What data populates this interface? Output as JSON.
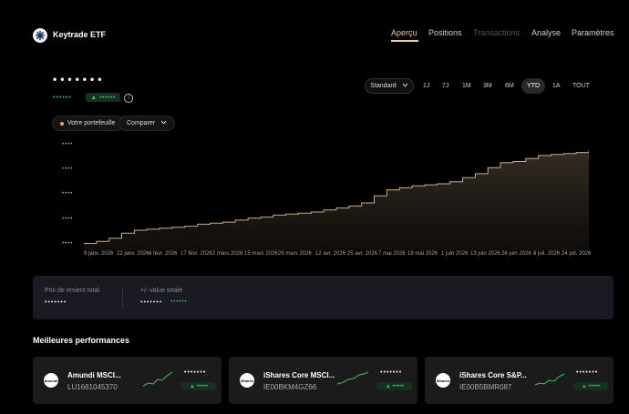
{
  "header": {
    "app_title": "Keytrade ETF",
    "nav": [
      {
        "label": "Aperçu"
      },
      {
        "label": "Positions"
      },
      {
        "label": "Transactions"
      },
      {
        "label": "Analyse"
      },
      {
        "label": "Paramètres"
      }
    ]
  },
  "summary": {
    "value_masked": "•••••••",
    "gain_masked": "••••••",
    "gain_badge": "▲ ••••••",
    "info": "i"
  },
  "controls": {
    "portfolio_label": "Votre portefeuille",
    "compare_label": "Comparer",
    "view_label": "Standard",
    "periods": [
      "1J",
      "7J",
      "1M",
      "3M",
      "6M",
      "YTD",
      "1A",
      "TOUT"
    ],
    "active_period": "YTD"
  },
  "chart_data": {
    "type": "area",
    "ytick_labels": [
      "••••",
      "••••",
      "••••",
      "••••",
      "••••"
    ],
    "xtick_labels": [
      "9 janv. 2026",
      "22 janv. 2026",
      "4 févr. 2026",
      "17 févr. 2026",
      "2 mars 2026",
      "15 mars 2026",
      "29 mars 2026",
      "12 avr. 2026",
      "25 avr. 2026",
      "7 mai 2026",
      "19 mai 2026",
      "1 juin 2026",
      "13 juin 2026",
      "26 juin 2026",
      "8 juil. 2026",
      "24 juil. 2026"
    ],
    "values": [
      0.05,
      0.07,
      0.1,
      0.15,
      0.18,
      0.19,
      0.2,
      0.21,
      0.22,
      0.24,
      0.25,
      0.26,
      0.28,
      0.3,
      0.31,
      0.33,
      0.34,
      0.35,
      0.36,
      0.38,
      0.4,
      0.42,
      0.45,
      0.52,
      0.58,
      0.6,
      0.62,
      0.63,
      0.64,
      0.66,
      0.7,
      0.74,
      0.8,
      0.85,
      0.86,
      0.89,
      0.92,
      0.93,
      0.94,
      0.95,
      0.97
    ],
    "ylim": [
      0,
      1
    ],
    "line_color": "#c8ab8a",
    "grid": false
  },
  "cost": {
    "cost_label": "Prix de revient total",
    "cost_value": "•••••••",
    "gain_label": "+/- value totale",
    "gain_value": "•••••••",
    "gain_value_green": "••••••"
  },
  "top_performers": {
    "title": "Meilleures performances",
    "items": [
      {
        "name": "Amundi MSCI...",
        "isin": "LU1681045370",
        "logo": "Amundi",
        "value": "•••••••",
        "badge": "▲ ••••••"
      },
      {
        "name": "iShares Core MSCI...",
        "isin": "IE00BKM4GZ66",
        "logo": "iShares",
        "value": "•••••••",
        "badge": "▲ ••••••"
      },
      {
        "name": "iShares Core S&P...",
        "isin": "IE00B5BMR087",
        "logo": "iShares",
        "value": "•••••••",
        "badge": "▲ ••••••"
      }
    ]
  },
  "colors": {
    "accent": "#e9c9a6",
    "positive": "#3fbf6a"
  }
}
